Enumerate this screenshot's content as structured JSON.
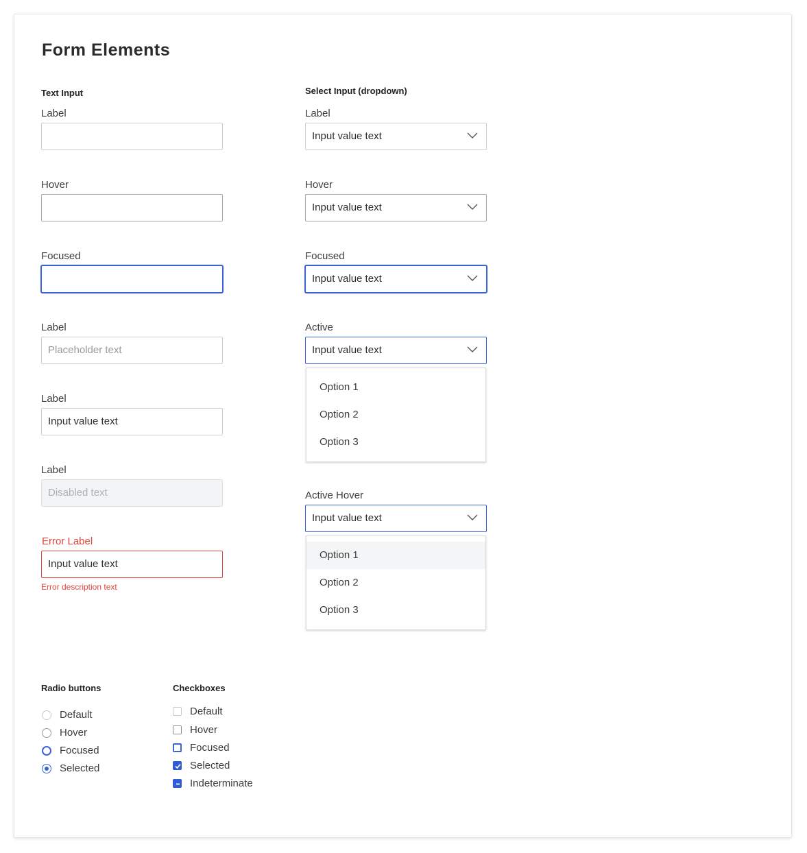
{
  "page": {
    "title": "Form Elements"
  },
  "text_input": {
    "section_title": "Text Input",
    "fields": [
      {
        "state": "default",
        "label": "Label",
        "value": "",
        "placeholder": ""
      },
      {
        "state": "hover",
        "label": "Hover",
        "value": "",
        "placeholder": ""
      },
      {
        "state": "focused",
        "label": "Focused",
        "value": "",
        "placeholder": ""
      },
      {
        "state": "placeholder",
        "label": "Label",
        "value": "",
        "placeholder": "Placeholder text"
      },
      {
        "state": "filled",
        "label": "Label",
        "value": "Input value text",
        "placeholder": ""
      },
      {
        "state": "disabled",
        "label": "Label",
        "value": "Disabled text",
        "placeholder": ""
      },
      {
        "state": "error",
        "label": "Error Label",
        "value": "Input value text",
        "placeholder": "",
        "error_description": "Error description text"
      }
    ]
  },
  "select_input": {
    "section_title": "Select Input (dropdown)",
    "fields": [
      {
        "state": "default",
        "label": "Label",
        "value": "Input value text"
      },
      {
        "state": "hover",
        "label": "Hover",
        "value": "Input value text"
      },
      {
        "state": "focused",
        "label": "Focused",
        "value": "Input value text"
      },
      {
        "state": "active",
        "label": "Active",
        "value": "Input value text",
        "options": [
          "Option 1",
          "Option 2",
          "Option 3"
        ]
      },
      {
        "state": "active-hover",
        "label": "Active Hover",
        "value": "Input value text",
        "options": [
          "Option 1",
          "Option 2",
          "Option 3"
        ],
        "highlighted_option": 0
      }
    ]
  },
  "radio_buttons": {
    "section_title": "Radio buttons",
    "items": [
      {
        "label": "Default",
        "state": "default"
      },
      {
        "label": "Hover",
        "state": "hover"
      },
      {
        "label": "Focused",
        "state": "focused"
      },
      {
        "label": "Selected",
        "state": "selected"
      }
    ]
  },
  "checkboxes": {
    "section_title": "Checkboxes",
    "items": [
      {
        "label": "Default",
        "state": "default"
      },
      {
        "label": "Hover",
        "state": "hover"
      },
      {
        "label": "Focused",
        "state": "focused"
      },
      {
        "label": "Selected",
        "state": "selected"
      },
      {
        "label": "Indeterminate",
        "state": "indeterminate"
      }
    ]
  },
  "colors": {
    "accent": "#3b63d9",
    "error": "#e0483e",
    "border": "#cfcfcf",
    "disabled_bg": "#f3f4f5"
  },
  "icons": {
    "select_chevron": "chevron-down-icon",
    "check": "check-icon",
    "dash": "dash-icon"
  }
}
